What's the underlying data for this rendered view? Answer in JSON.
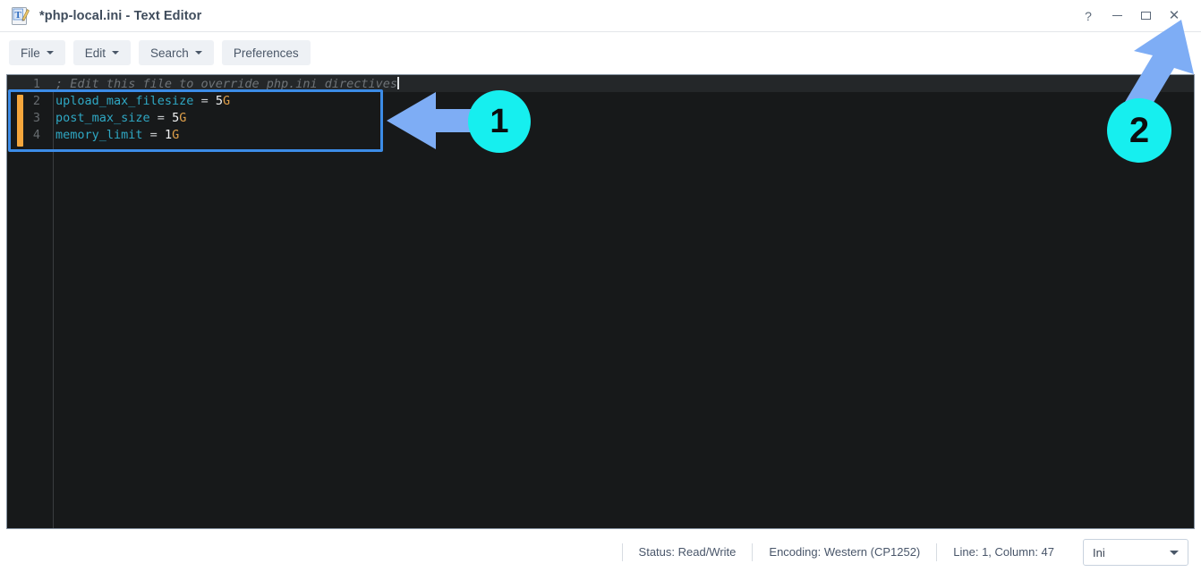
{
  "window": {
    "title": "*php-local.ini - Text Editor",
    "app_icon": "text-editor-icon",
    "controls": {
      "help": "?",
      "minimize": "minimize-icon",
      "maximize": "maximize-icon",
      "close": "✕"
    }
  },
  "toolbar": {
    "buttons": [
      {
        "label": "File",
        "has_caret": true
      },
      {
        "label": "Edit",
        "has_caret": true
      },
      {
        "label": "Search",
        "has_caret": true
      },
      {
        "label": "Preferences",
        "has_caret": false
      }
    ]
  },
  "editor": {
    "background": "#17191a",
    "lines": [
      {
        "number": "1",
        "current": true,
        "tokens": [
          {
            "text": "; Edit this file to override php.ini directives",
            "type": "comment"
          }
        ],
        "cursor_after": true
      },
      {
        "number": "2",
        "current": false,
        "tokens": [
          {
            "text": "upload_max_filesize",
            "type": "key"
          },
          {
            "text": " = ",
            "type": "eq"
          },
          {
            "text": "5",
            "type": "num"
          },
          {
            "text": "G",
            "type": "unit"
          }
        ],
        "cursor_after": false
      },
      {
        "number": "3",
        "current": false,
        "tokens": [
          {
            "text": "post_max_size",
            "type": "key"
          },
          {
            "text": " = ",
            "type": "eq"
          },
          {
            "text": "5",
            "type": "num"
          },
          {
            "text": "G",
            "type": "unit"
          }
        ],
        "cursor_after": false
      },
      {
        "number": "4",
        "current": false,
        "tokens": [
          {
            "text": "memory_limit",
            "type": "key"
          },
          {
            "text": " = ",
            "type": "eq"
          },
          {
            "text": "1",
            "type": "num"
          },
          {
            "text": "G",
            "type": "unit"
          }
        ],
        "cursor_after": false
      }
    ]
  },
  "statusbar": {
    "status": "Status: Read/Write",
    "encoding": "Encoding: Western (CP1252)",
    "position": "Line: 1, Column: 47",
    "language": "Ini"
  },
  "annotations": {
    "badge_color": "#16efef",
    "arrow_color": "#7eadf5",
    "items": [
      {
        "number": "1",
        "points_to": "edited-directives-block"
      },
      {
        "number": "2",
        "points_to": "window-close-button"
      }
    ]
  }
}
